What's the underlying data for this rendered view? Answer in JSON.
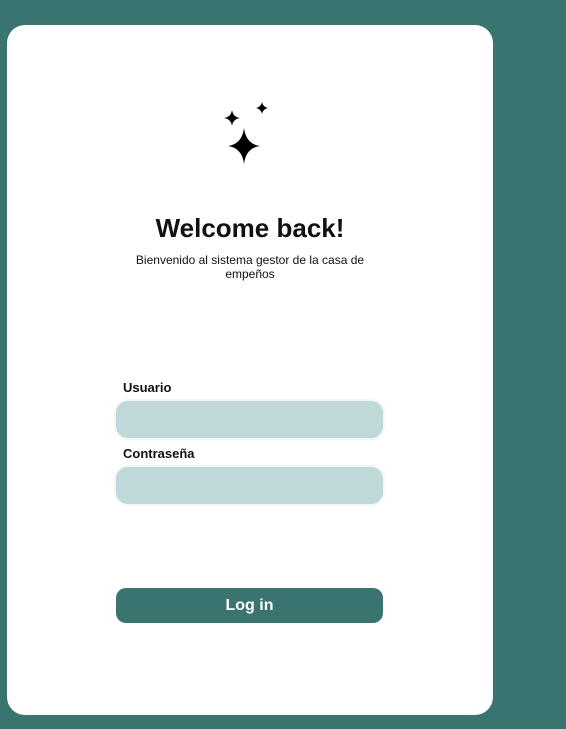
{
  "login": {
    "title": "Welcome back!",
    "subtitle": "Bienvenido al sistema gestor de la casa de empeños",
    "logo_icon": "sparkles-icon",
    "username": {
      "label": "Usuario",
      "value": "",
      "placeholder": ""
    },
    "password": {
      "label": "Contraseña",
      "value": "",
      "placeholder": ""
    },
    "submit_label": "Log in"
  },
  "colors": {
    "background": "#3a7470",
    "card": "#ffffff",
    "input_fill": "#bfd9d9",
    "button": "#3a7470",
    "button_text": "#ffffff"
  }
}
